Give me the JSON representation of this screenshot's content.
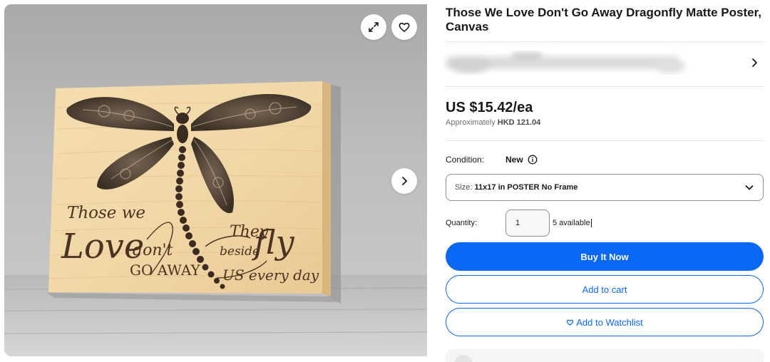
{
  "gallery": {
    "image_caption": {
      "line1": "Those we",
      "love": "Love",
      "dont": "don't",
      "go_away": "GO AWAY",
      "they": "They",
      "beside": "beside",
      "fly": "fly",
      "us_every_day": "US every day"
    },
    "expand_icon": "expand-icon",
    "heart_icon": "heart-icon",
    "next_icon": "chevron-right-icon"
  },
  "listing": {
    "title": "Those We Love Don't Go Away Dragonfly Matte Poster, Canvas",
    "price": "US $15.42/ea",
    "approx_prefix": "Approximately",
    "approx_value": "HKD 121.04",
    "condition_label": "Condition:",
    "condition_value": "New",
    "size_prefix": "Size:",
    "size_value": "11x17 in POSTER No Frame",
    "quantity_label": "Quantity:",
    "quantity_value": "1",
    "available": "5 available",
    "buy_now": "Buy It Now",
    "add_to_cart": "Add to cart",
    "add_to_watchlist": "Add to Watchlist"
  },
  "colors": {
    "accent": "#0968f6",
    "text": "#191919",
    "muted": "#707070"
  }
}
